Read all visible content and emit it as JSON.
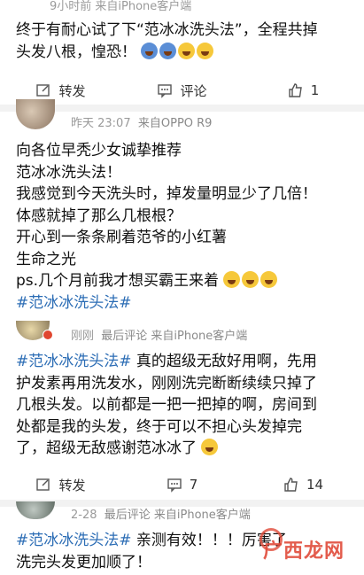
{
  "top_post": {
    "meta": "9小时前  来自iPhone客户端",
    "lines": [
      "终于有耐心试了下“范冰冰洗头法”，全程共掉",
      "头发八根，惶恐！"
    ],
    "emojis": [
      "scream-face",
      "scream-face",
      "grin-face",
      "grin-face"
    ],
    "actions": {
      "repost": "转发",
      "comment": "评论",
      "like": "1"
    }
  },
  "post2": {
    "time": "昨天 23:07",
    "source": "来自OPPO R9",
    "lines": [
      "向各位早秃少女诚挚推荐",
      "范冰冰洗头法！",
      "我感觉到今天洗头时，掉发量明显少了几倍！",
      "体感就掉了那么几根根？",
      "开心到一条条刷着范爷的小红薯",
      "生命之光",
      "ps.几个月前我才想买霸王来着"
    ],
    "hashtag": "#范冰冰洗头法#",
    "emojis": [
      "thinking-face",
      "thinking-face",
      "thinking-face"
    ]
  },
  "post3": {
    "time": "刚刚",
    "source": "最后评论  来自iPhone客户端",
    "first_line_tag": "#范冰冰洗头法#",
    "first_line_rest": " 真的超级无敌好用啊，先用",
    "lines": [
      "护发素再用洗发水，刚刚洗完断断续续只掉了",
      "几根头发。以前都是一把一把掉的啊，房间到",
      "处都是我的头发，终于可以不担心头发掉完",
      "了，超级无敌感谢范冰冰了"
    ],
    "emojis": [
      "tear-face"
    ],
    "actions": {
      "repost": "转发",
      "comment": "7",
      "like": "14"
    }
  },
  "post4": {
    "time": "2-28",
    "source": "最后评论  来自iPhone客户端",
    "tag": "#范冰冰洗头法#",
    "rest": " 亲测有效！！！厉害了",
    "line2": "洗完头发更加顺了！"
  },
  "watermark": "广西龙网"
}
